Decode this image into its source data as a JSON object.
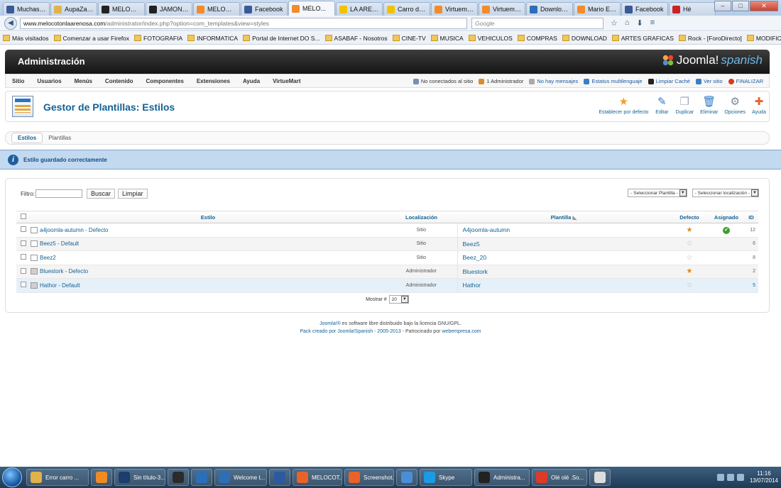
{
  "browser": {
    "tabs": [
      {
        "label": "Muchas ...",
        "color": "#3b5998"
      },
      {
        "label": "AupaZara...",
        "color": "#e0b24a"
      },
      {
        "label": "MELOCO...",
        "color": "#222222"
      },
      {
        "label": "JAMONE...",
        "color": "#222222"
      },
      {
        "label": "MELOCO...",
        "color": "#f28b2a"
      },
      {
        "label": "Facebook",
        "color": "#3b5998"
      },
      {
        "label": "MELO...",
        "color": "#f28b2a",
        "active": true
      },
      {
        "label": "LA AREN...",
        "color": "#f2c200"
      },
      {
        "label": "Carro de ...",
        "color": "#f2c200"
      },
      {
        "label": "Virtuema...",
        "color": "#f28b2a"
      },
      {
        "label": "Virtuema...",
        "color": "#f28b2a"
      },
      {
        "label": "Downloads",
        "color": "#2c6fb7"
      },
      {
        "label": "Mario Ele...",
        "color": "#f28b2a"
      },
      {
        "label": "Facebook",
        "color": "#3b5998"
      },
      {
        "label": "Hé",
        "color": "#cc2222"
      }
    ],
    "url_host": "www.melocotonlaarenosa.com",
    "url_path": "/administrator/index.php?option=com_templates&view=styles",
    "search_placeholder": "Google",
    "bookmarks": [
      "Más visitados",
      "Comenzar a usar Firefox",
      "FOTOGRAFIA",
      "INFORMATICA",
      "Portal de Internet DO S...",
      "ASABAF - Nosotros",
      "CINE-TV",
      "MUSICA",
      "VEHICULOS",
      "COMPRAS",
      "DOWNLOAD",
      "ARTES GRAFICAS",
      "Rock - [ForoDirecto]",
      "MODIFICAR PERFIL"
    ]
  },
  "admin": {
    "header_title": "Administración",
    "logo_text": "Joomla!",
    "logo_suffix": "spanish",
    "menu": [
      "Sitio",
      "Usuarios",
      "Menús",
      "Contenido",
      "Componentes",
      "Extensiones",
      "Ayuda",
      "VirtueMart"
    ],
    "status": [
      "No conectados al sitio",
      "1 Administrador",
      "No hay mensajes",
      "Estatus multilenguaje",
      "Limpiar Caché",
      "Ver sitio",
      "FINALIZAR"
    ],
    "page_title": "Gestor de Plantillas: Estilos",
    "toolbar": [
      {
        "label": "Establecer por defecto",
        "icon": "star-icon"
      },
      {
        "label": "Editar",
        "icon": "edit-icon"
      },
      {
        "label": "Duplicar",
        "icon": "copy-icon"
      },
      {
        "label": "Eliminar",
        "icon": "trash-icon"
      },
      {
        "label": "Opciones",
        "icon": "options-icon"
      },
      {
        "label": "Ayuda",
        "icon": "help-icon"
      }
    ],
    "subtabs": [
      "Estilos",
      "Plantillas"
    ],
    "message": "Estilo guardado correctamente",
    "filter_label": "Filtro:",
    "filter_value": "",
    "search_button": "Buscar",
    "clear_button": "Limpiar",
    "select_template": "- Seleccionar Plantilla -",
    "select_location": "- Seleccionar localización -",
    "columns": {
      "estilo": "Estilo",
      "localizacion": "Localización",
      "plantilla": "Plantilla",
      "defecto": "Defecto",
      "asignado": "Asignado",
      "id": "ID"
    },
    "rows": [
      {
        "style": "a4joomla-autumn - Defecto",
        "location": "Sitio",
        "template": "A4joomla-autumn",
        "default": true,
        "assigned": true,
        "id": "12"
      },
      {
        "style": "Beez5 - Default",
        "location": "Sitio",
        "template": "Beez5",
        "default": false,
        "assigned": false,
        "id": "6"
      },
      {
        "style": "Beez2",
        "location": "Sitio",
        "template": "Beez_20",
        "default": false,
        "assigned": false,
        "id": "8"
      },
      {
        "style": "Bluestork - Defecto",
        "location": "Administrador",
        "template": "Bluestork",
        "default": true,
        "assigned": false,
        "id": "2"
      },
      {
        "style": "Hathor - Default",
        "location": "Administrador",
        "template": "Hathor",
        "default": false,
        "assigned": false,
        "id": "5"
      }
    ],
    "show_label": "Mostrar #",
    "show_value": "20",
    "footer_line1_link": "Joomla!®",
    "footer_line1_text": " es software libre distribuido bajo la licencia GNU/GPL.",
    "footer_line2_link1": "Pack creado por Joomla!Spanish - 2005-2013",
    "footer_line2_text": " - Patrocinado por ",
    "footer_line2_link2": "webempresa.com"
  },
  "taskbar": {
    "items": [
      {
        "label": "Error carro ...",
        "color": "#e0b24a"
      },
      {
        "label": "",
        "color": "#f08a24"
      },
      {
        "label": "Sin título-3...",
        "color": "#1c3d6e"
      },
      {
        "label": "",
        "color": "#2b2b2b"
      },
      {
        "label": "",
        "color": "#2c6fb7"
      },
      {
        "label": "Welcome t...",
        "color": "#2c6fb7"
      },
      {
        "label": "",
        "color": "#2c5aa0"
      },
      {
        "label": "MELOCOT...",
        "color": "#e8622a"
      },
      {
        "label": "Screenshot...",
        "color": "#e8622a"
      },
      {
        "label": "",
        "color": "#4a8ed8"
      },
      {
        "label": "Skype",
        "color": "#1a9be6"
      },
      {
        "label": "Administra...",
        "color": "#222222"
      },
      {
        "label": "Olé olé .So...",
        "color": "#dd3a2a"
      },
      {
        "label": "",
        "color": "#dddddd"
      }
    ],
    "time": "11:16",
    "date": "13/07/2014"
  }
}
